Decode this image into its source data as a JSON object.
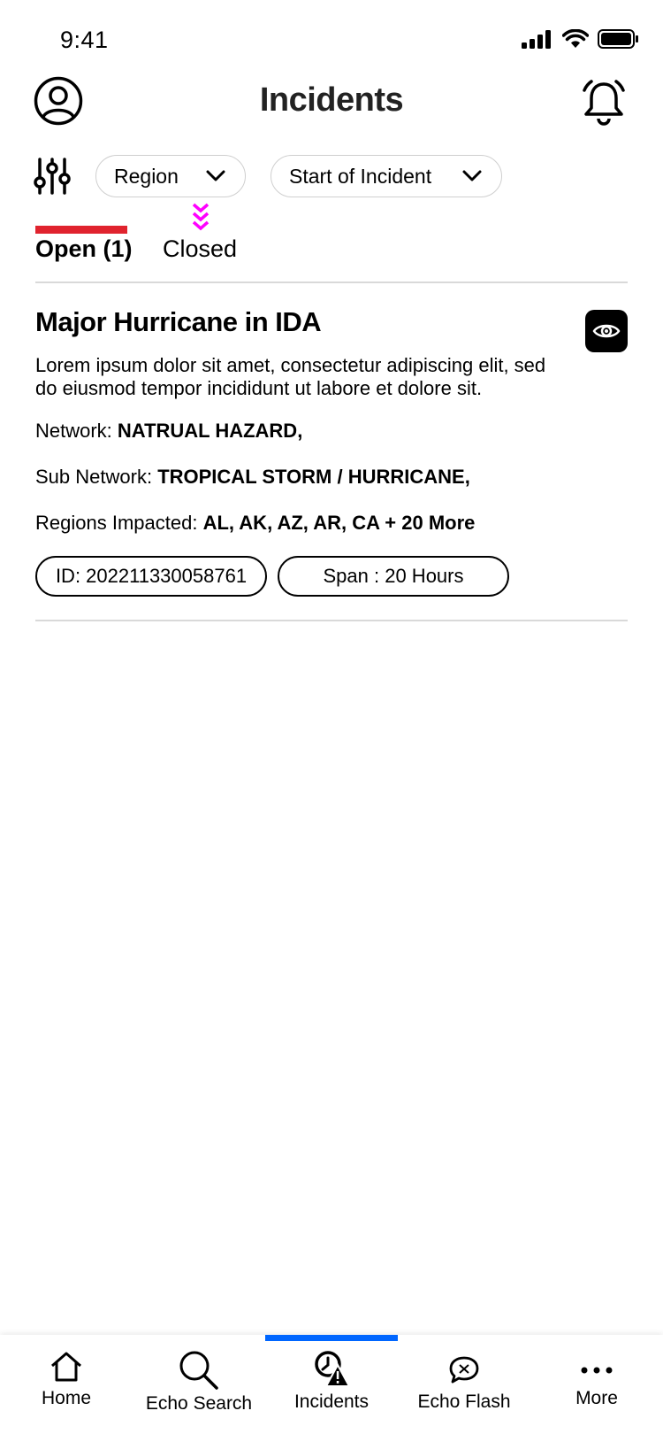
{
  "status_bar": {
    "time": "9:41"
  },
  "header": {
    "title": "Incidents"
  },
  "filters": {
    "region_label": "Region",
    "start_label": "Start of Incident"
  },
  "tabs": [
    {
      "label": "Open (1)",
      "active": true
    },
    {
      "label": "Closed",
      "active": false
    }
  ],
  "colors": {
    "active_tab": "#e0232e",
    "nav_active": "#0066ff"
  },
  "incident": {
    "title": "Major Hurricane in IDA",
    "description": "Lorem ipsum dolor sit amet, consectetur adipiscing elit, sed do eiusmod tempor incididunt ut labore et dolore sit.",
    "network_label": "Network:",
    "network_value": "NATRUAL HAZARD,",
    "subnetwork_label": "Sub Network:",
    "subnetwork_value": "TROPICAL STORM / HURRICANE,",
    "regions_label": "Regions Impacted:",
    "regions_value": "AL, AK, AZ, AR, CA + 20 More",
    "id_chip": "ID: 202211330058761",
    "span_chip": "Span : 20 Hours",
    "view_icon": "eye-icon"
  },
  "bottom_nav": [
    {
      "label": "Home",
      "icon": "home-icon"
    },
    {
      "label": "Echo Search",
      "icon": "search-icon"
    },
    {
      "label": "Incidents",
      "icon": "incident-alert-icon",
      "active": true
    },
    {
      "label": "Echo Flash",
      "icon": "chat-bubble-icon"
    },
    {
      "label": "More",
      "icon": "more-dots-icon"
    }
  ]
}
